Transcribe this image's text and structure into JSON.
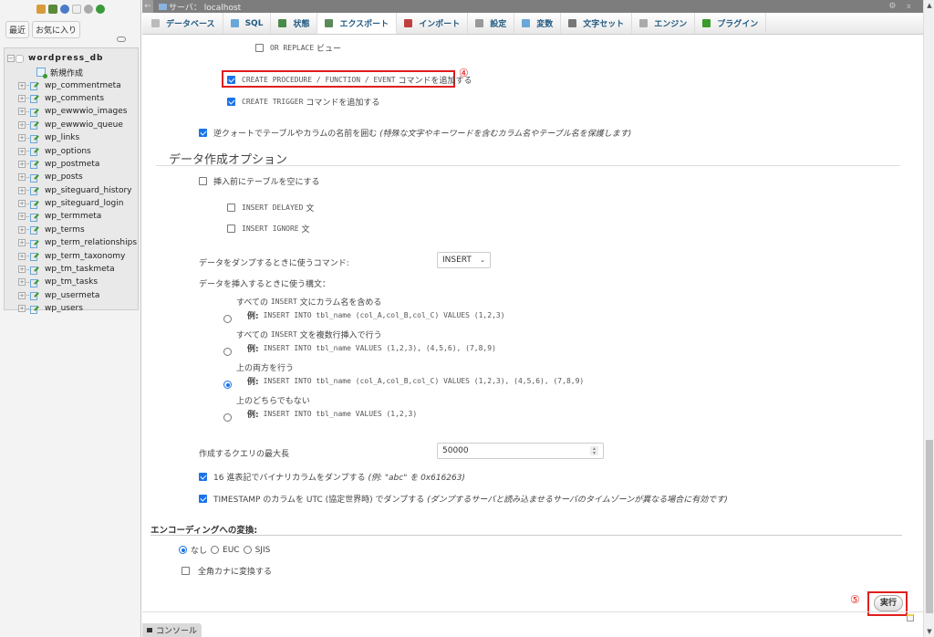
{
  "sidebar": {
    "logo_icons": [
      "home-icon",
      "logout-icon",
      "help-icon",
      "docs-icon",
      "settings-icon",
      "reload-icon"
    ],
    "tabs": [
      "最近",
      "お気に入り"
    ],
    "database": "wordpress_db",
    "new_item": "新規作成",
    "tables": [
      "wp_commentmeta",
      "wp_comments",
      "wp_ewwwio_images",
      "wp_ewwwio_queue",
      "wp_links",
      "wp_options",
      "wp_postmeta",
      "wp_posts",
      "wp_siteguard_history",
      "wp_siteguard_login",
      "wp_termmeta",
      "wp_terms",
      "wp_term_relationships",
      "wp_term_taxonomy",
      "wp_tm_taskmeta",
      "wp_tm_tasks",
      "wp_usermeta",
      "wp_users"
    ]
  },
  "topbar": {
    "back": "←",
    "server": "サーバ： localhost",
    "gear": "⚙",
    "collapse": "⌅"
  },
  "menu": [
    {
      "label": "データベース",
      "color": "#bbbbbb"
    },
    {
      "label": "SQL",
      "color": "#6aa7d8"
    },
    {
      "label": "状態",
      "color": "#4a8a4a"
    },
    {
      "label": "エクスポート",
      "color": "#5a8a5a",
      "active": true
    },
    {
      "label": "インポート",
      "color": "#c04040"
    },
    {
      "label": "設定",
      "color": "#999999"
    },
    {
      "label": "変数",
      "color": "#6aa7d8"
    },
    {
      "label": "文字セット",
      "color": "#777777"
    },
    {
      "label": "エンジン",
      "color": "#aaaaaa"
    },
    {
      "label": "プラグイン",
      "color": "#3a9a2a"
    }
  ],
  "options": {
    "or_replace": {
      "code": "OR REPLACE",
      "text": "ビュー",
      "checked": false
    },
    "create_procedure": {
      "code": "CREATE PROCEDURE / FUNCTION / EVENT",
      "text": "コマンドを追加する",
      "checked": true
    },
    "create_trigger": {
      "code": "CREATE TRIGGER",
      "text": "コマンドを追加する",
      "checked": true
    },
    "backquotes": {
      "text": "逆クォートでテーブルやカラムの名前を囲む",
      "note": "(特殊な文字やキーワードを含むカラム名やテーブル名を保護します)",
      "checked": true
    },
    "marker4": "④"
  },
  "data_section": {
    "title": "データ作成オプション",
    "truncate": {
      "text": "挿入前にテーブルを空にする",
      "checked": false
    },
    "insert_delayed": {
      "code": "INSERT DELAYED",
      "text": "文",
      "checked": false
    },
    "insert_ignore": {
      "code": "INSERT IGNORE",
      "text": "文",
      "checked": false
    },
    "dump_command_label": "データをダンプするときに使うコマンド:",
    "dump_command_value": "INSERT",
    "syntax_label": "データを挿入するときに使う構文：",
    "syntax_options": [
      {
        "title_pre": "すべての",
        "title_code": "INSERT",
        "title_post": "文にカラム名を含める",
        "example_label": "例:",
        "example": "INSERT INTO tbl_name (col_A,col_B,col_C) VALUES (1,2,3)",
        "selected": false
      },
      {
        "title_pre": "すべての",
        "title_code": "INSERT",
        "title_post": "文を複数行挿入で行う",
        "example_label": "例:",
        "example": "INSERT INTO tbl_name VALUES (1,2,3), (4,5,6), (7,8,9)",
        "selected": false
      },
      {
        "title_pre": "上の両方を行う",
        "title_code": "",
        "title_post": "",
        "example_label": "例:",
        "example": "INSERT INTO tbl_name (col_A,col_B,col_C) VALUES (1,2,3), (4,5,6), (7,8,9)",
        "selected": true
      },
      {
        "title_pre": "上のどちらでもない",
        "title_code": "",
        "title_post": "",
        "example_label": "例:",
        "example": "INSERT INTO tbl_name VALUES (1,2,3)",
        "selected": false
      }
    ],
    "max_query_label": "作成するクエリの最大長",
    "max_query_value": "50000",
    "hex_binary": {
      "text": "16 進表記でバイナリカラムをダンプする",
      "note": "(例: \"abc\" を 0x616263)",
      "checked": true
    },
    "utc": {
      "text": "TIMESTAMP のカラムを UTC (協定世界時) でダンプする",
      "note": "(ダンプするサーバと読み込ませるサーバのタイムゾーンが異なる場合に有効です)",
      "checked": true
    }
  },
  "encoding": {
    "title": "エンコーディングへの変換:",
    "options": [
      {
        "label": "なし",
        "selected": true
      },
      {
        "label": "EUC",
        "selected": false
      },
      {
        "label": "SJIS",
        "selected": false
      }
    ],
    "kana": {
      "text": "全角カナに変換する",
      "checked": false
    }
  },
  "go_button": "実行",
  "marker5": "⑤",
  "console": "コンソール"
}
